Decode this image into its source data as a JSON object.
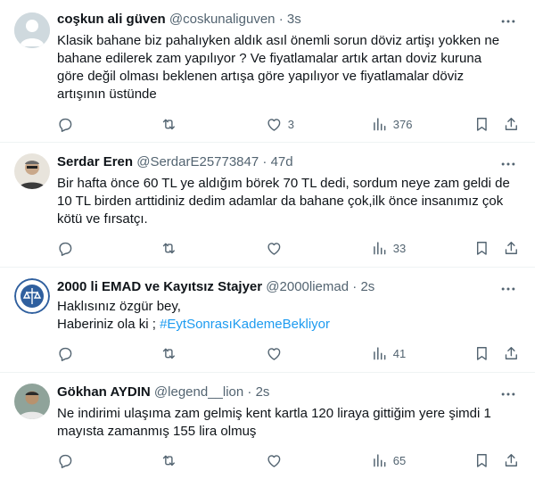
{
  "tweets": [
    {
      "name": "coşkun ali güven",
      "handle": "@coskunaliguven",
      "sep": "·",
      "time": "3s",
      "avatar": "default-avatar",
      "lines": [
        "Klasik bahane biz pahalıyken aldık asıl önemli sorun döviz artişı yokken ne",
        "bahane edilerek zam yapılıyor ? Ve fiyatlamalar artık artan doviz kuruna",
        "göre değil olması beklenen artışa göre yapılıyor ve fiyatlamalar döviz",
        "artışının üstünde"
      ],
      "likes": "3",
      "views": "376"
    },
    {
      "name": "Serdar Eren",
      "handle": "@SerdarE25773847",
      "sep": "·",
      "time": "47d",
      "avatar": "photo-avatar",
      "lines": [
        "Bir hafta önce 60 TL ye aldığım börek 70 TL dedi, sordum neye zam geldi de",
        "10 TL birden arttidiniz dedim adamlar da bahane çok,ilk önce insanımız çok",
        "kötü ve fırsatçı."
      ],
      "likes": "",
      "views": "33"
    },
    {
      "name": "2000 li EMAD ve Kayıtsız Stajyer",
      "handle": "@2000liemad",
      "sep": "·",
      "time": "2s",
      "avatar": "emblem-avatar",
      "lines": [
        "Haklısınız özgür bey,",
        "Haberiniz ola ki ;"
      ],
      "hashtag": "#EytSonrasıKademeBekliyor",
      "likes": "",
      "views": "41"
    },
    {
      "name": "Gökhan AYDIN",
      "handle": "@legend__lion",
      "sep": "·",
      "time": "2s",
      "avatar": "photo-avatar",
      "lines": [
        "Ne indirimi ulaşıma zam gelmiş kent kartla 120 liraya gittiğim yere şimdi 1",
        "mayısta zamanmış 155 lira olmuş"
      ],
      "likes": "",
      "views": "65"
    }
  ],
  "icons": {
    "more": "more-dots-icon",
    "reply": "reply-icon",
    "retweet": "retweet-icon",
    "like": "like-icon",
    "views": "views-icon",
    "bookmark": "bookmark-icon",
    "share": "share-icon"
  },
  "colors": {
    "text": "#0f1419",
    "secondary": "#536471",
    "link": "#1d9bf0",
    "divider": "#eff3f4"
  }
}
